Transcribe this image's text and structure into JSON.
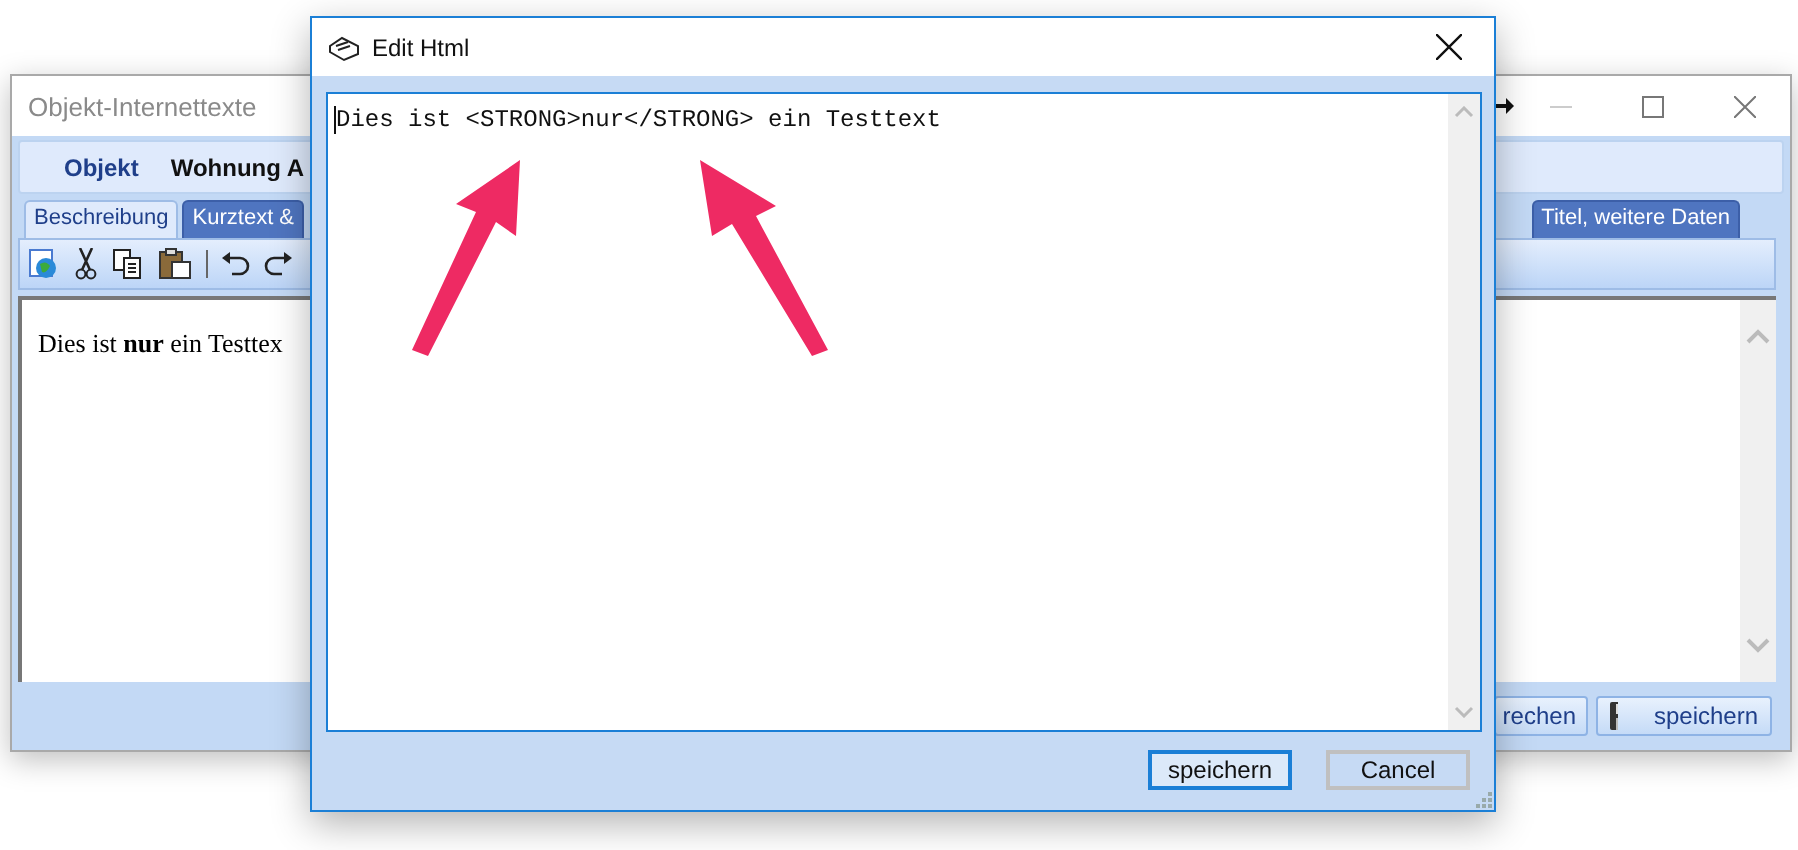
{
  "background_window": {
    "title": "Objekt-Internettexte",
    "toolbar": [
      "Objekt",
      "Wohnung A"
    ],
    "tabs": [
      {
        "label": "Beschreibung",
        "selected": true
      },
      {
        "label": "Kurztext &",
        "selected": false
      },
      {
        "label": "Titel, weitere Daten",
        "selected": false
      }
    ],
    "content": "Dies ist **nur** ein Testtex",
    "buttons": [
      "rechen",
      "speichern"
    ]
  },
  "dialog": {
    "title": "Edit Html",
    "editor_text": "Dies ist <STRONG>nur</STRONG> ein Testtext",
    "buttons": [
      {
        "label": "speichern",
        "default": true
      },
      {
        "label": "Cancel",
        "default": false
      }
    ]
  }
}
